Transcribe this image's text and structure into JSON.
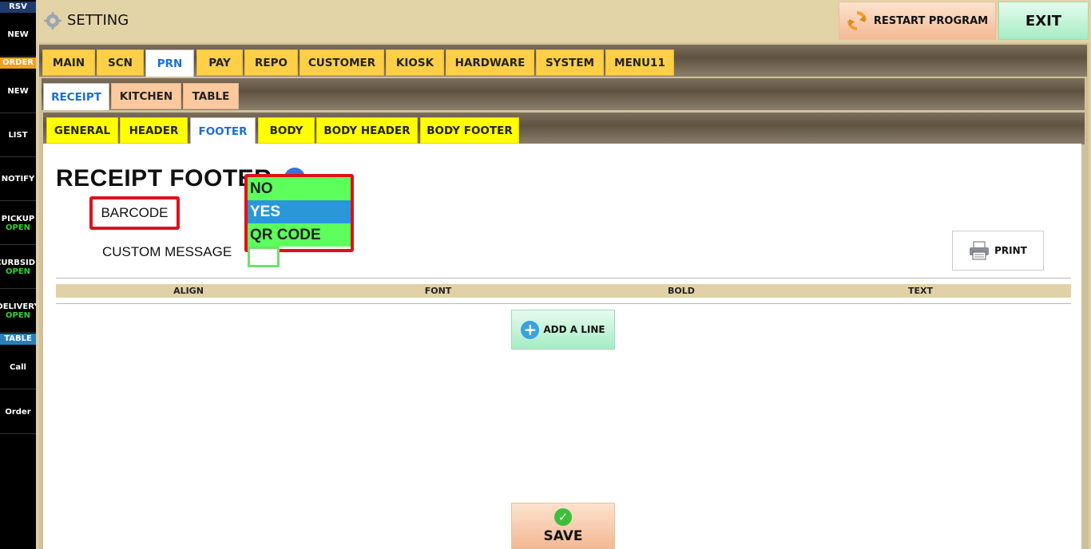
{
  "sidebar": {
    "rsv_header": "RSV",
    "rsv_new": "NEW",
    "order_header": "ORDER",
    "order_new": "NEW",
    "list": "LIST",
    "notify": "NOTIFY",
    "pickup": "PICKUP",
    "pickup_status": "OPEN",
    "curbside": "CURBSIDE",
    "curbside_status": "OPEN",
    "delivery": "DELIVERY",
    "delivery_status": "OPEN",
    "table_header": "TABLE",
    "call": "Call",
    "order": "Order"
  },
  "header": {
    "title": "SETTING",
    "restart_label": "RESTART PROGRAM",
    "exit_label": "EXIT"
  },
  "main_tabs": [
    "MAIN",
    "SCN",
    "PRN",
    "PAY",
    "REPO",
    "CUSTOMER",
    "KIOSK",
    "HARDWARE",
    "SYSTEM",
    "MENU11"
  ],
  "main_tabs_active": "PRN",
  "prn_tabs": [
    "RECEIPT",
    "KITCHEN",
    "TABLE"
  ],
  "prn_tabs_active": "RECEIPT",
  "receipt_tabs": [
    "GENERAL",
    "HEADER",
    "FOOTER",
    "BODY",
    "BODY HEADER",
    "BODY FOOTER"
  ],
  "receipt_tabs_active": "FOOTER",
  "content": {
    "heading": "RECEIPT FOOTER",
    "barcode_label": "BARCODE",
    "barcode_options": [
      "NO",
      "YES",
      "QR CODE"
    ],
    "barcode_selected": "YES",
    "custom_message_label": "CUSTOM MESSAGE",
    "print_label": "PRINT",
    "table_columns": [
      "ALIGN",
      "FONT",
      "BOLD",
      "TEXT"
    ],
    "add_line_label": "ADD A LINE",
    "save_label": "SAVE"
  },
  "colors": {
    "highlight": "#e0101a",
    "option_green": "#5cff5c",
    "option_selected": "#2a98d8",
    "active_tab_text": "#1a6fd6"
  }
}
